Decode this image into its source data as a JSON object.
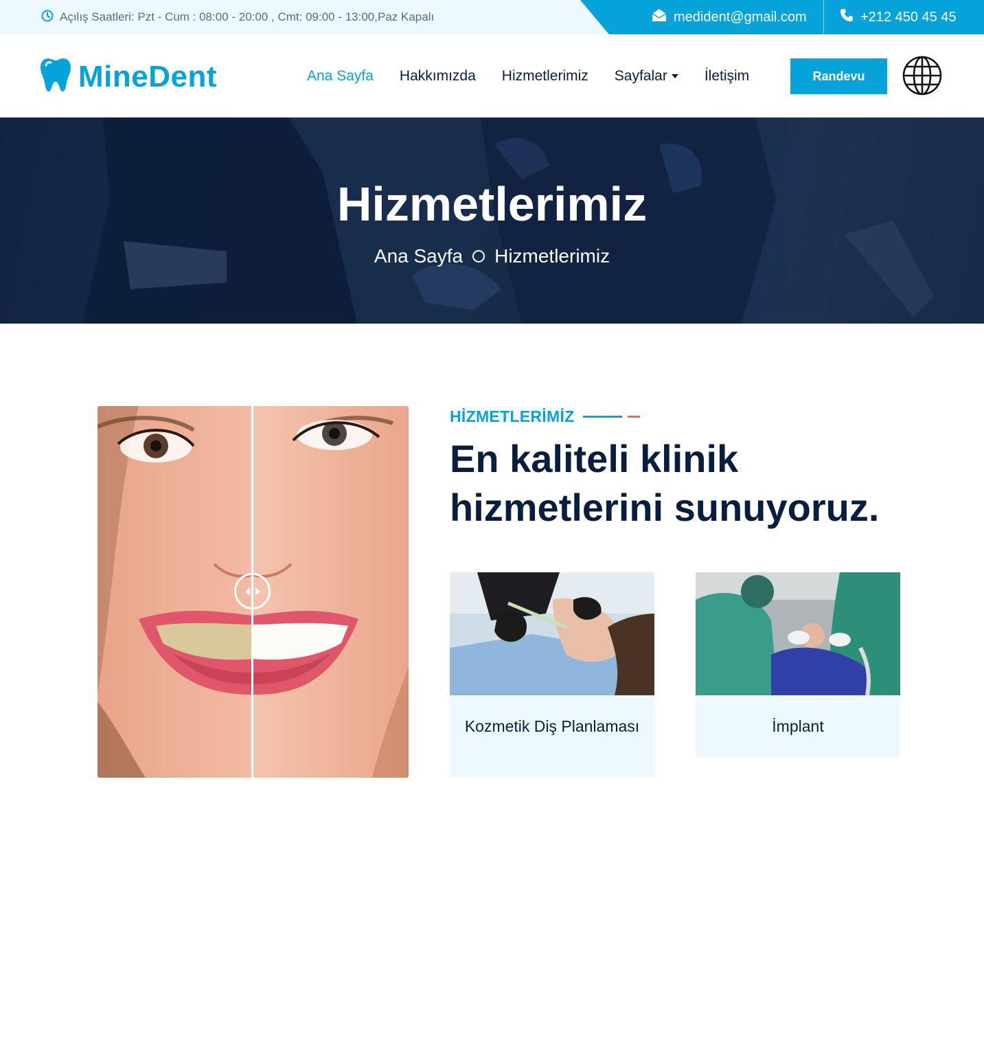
{
  "topbar": {
    "hours_icon": "clock-icon",
    "hours": "Açılış Saatleri: Pzt - Cum : 08:00 - 20:00 , Cmt: 09:00 - 13:00,Paz Kapalı",
    "email_icon": "envelope-open-icon",
    "email": "medident@gmail.com",
    "phone_icon": "phone-icon",
    "phone": "+212 450 45 45"
  },
  "brand": {
    "logo_icon": "tooth-icon",
    "name": "MineDent",
    "color": "#06a3da"
  },
  "nav": {
    "items": [
      {
        "label": "Ana Sayfa",
        "active": true
      },
      {
        "label": "Hakkımızda"
      },
      {
        "label": "Hizmetlerimiz"
      },
      {
        "label": "Sayfalar",
        "dropdown": true
      },
      {
        "label": "İletişim"
      }
    ],
    "cta": "Randevu",
    "language_icon": "globe-icon"
  },
  "hero": {
    "title": "Hizmetlerimiz",
    "breadcrumb": [
      "Ana Sayfa",
      "Hizmetlerimiz"
    ]
  },
  "services": {
    "kicker": "HİZMETLERİMİZ",
    "title": "En kaliteli klinik hizmetlerini sunuyoruz.",
    "compare_handle_icon": "left-right-arrows-icon",
    "cards": [
      {
        "label": "Kozmetik Diş Planlaması"
      },
      {
        "label": "İmplant"
      }
    ]
  },
  "colors": {
    "primary": "#06a3da",
    "dark": "#091e3e",
    "accent": "#eb6b56",
    "light": "#eef9ff"
  }
}
